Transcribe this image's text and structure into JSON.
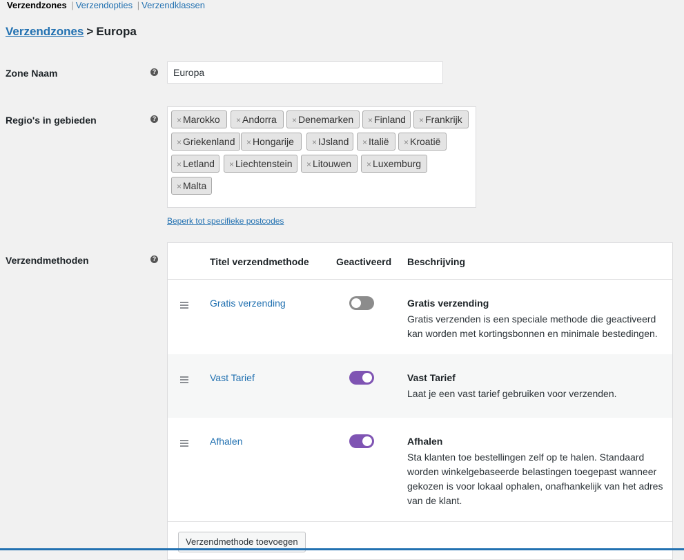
{
  "subnav": {
    "items": [
      "Verzendzones",
      "Verzendopties",
      "Verzendklassen"
    ],
    "separator": "|"
  },
  "breadcrumb": {
    "link": "Verzendzones",
    "separator": ">",
    "current": "Europa"
  },
  "help_icon": "?",
  "zone_name": {
    "label": "Zone Naam",
    "value": "Europa"
  },
  "regions": {
    "label": "Regio's in gebieden",
    "remove_glyph": "×",
    "chips": [
      "Marokko",
      "Andorra",
      "Denemarken",
      "Finland",
      "Frankrijk",
      "Griekenland",
      "Hongarije",
      "IJsland",
      "Italië",
      "Kroatië",
      "Letland",
      "Liechtenstein",
      "Litouwen",
      "Luxemburg",
      "Malta"
    ],
    "postcode_link": "Beperk tot specifieke postcodes"
  },
  "methods": {
    "label": "Verzendmethoden",
    "columns": [
      "Titel verzendmethode",
      "Geactiveerd",
      "Beschrijving"
    ],
    "rows": [
      {
        "title": "Gratis verzending",
        "enabled": false,
        "desc_title": "Gratis verzending",
        "desc": "Gratis verzenden is een speciale methode die geactiveerd kan worden met kortingsbonnen en minimale bestedingen."
      },
      {
        "title": "Vast Tarief",
        "enabled": true,
        "desc_title": "Vast Tarief",
        "desc": "Laat je een vast tarief gebruiken voor verzenden."
      },
      {
        "title": "Afhalen",
        "enabled": true,
        "desc_title": "Afhalen",
        "desc": "Sta klanten toe bestellingen zelf op te halen. Standaard worden winkelgebaseerde belastingen toegepast wanneer gekozen is voor lokaal ophalen, onafhankelijk van het adres van de klant."
      }
    ],
    "add_button": "Verzendmethode toevoegen"
  },
  "colors": {
    "link": "#2271b1",
    "toggle_on": "#7f54b3",
    "toggle_off": "#8c8c8c"
  }
}
